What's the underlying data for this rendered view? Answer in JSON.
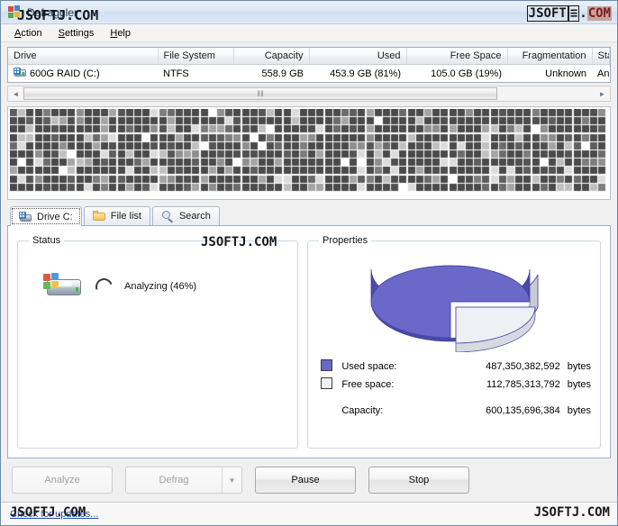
{
  "window": {
    "title": "Defraggler",
    "icon": "app-tiles-icon"
  },
  "watermarks": {
    "title_overlay": "JSOFTJ.COM",
    "titlebar_right": "JSOFTJ.COM",
    "center": "JSOFTJ.COM",
    "status_left": "JSOFTJ.COM",
    "status_right": "JSOFTJ.COM"
  },
  "menu": {
    "items": [
      {
        "accel": "A",
        "rest": "ction"
      },
      {
        "accel": "S",
        "rest": "ettings"
      },
      {
        "accel": "H",
        "rest": "elp"
      }
    ]
  },
  "drive_table": {
    "columns": [
      {
        "label": "Drive",
        "align": "left"
      },
      {
        "label": "File System",
        "align": "left"
      },
      {
        "label": "Capacity",
        "align": "right"
      },
      {
        "label": "Used",
        "align": "right"
      },
      {
        "label": "Free Space",
        "align": "right"
      },
      {
        "label": "Fragmentation",
        "align": "right"
      },
      {
        "label": "Status",
        "align": "left"
      }
    ],
    "rows": [
      {
        "drive": "600G RAID (C:)",
        "file_system": "NTFS",
        "capacity": "558.9 GB",
        "used": "453.9 GB (81%)",
        "free_space": "105.0 GB (19%)",
        "fragmentation": "Unknown",
        "status": "Analyzing ("
      }
    ]
  },
  "scrollbar": {
    "left_arrow": "◄",
    "right_arrow": "►",
    "grip": "‖‖"
  },
  "tabs": [
    {
      "label": "Drive C:",
      "icon": "drive-icon",
      "active": true
    },
    {
      "label": "File list",
      "icon": "folder-icon",
      "active": false
    },
    {
      "label": "Search",
      "icon": "magnifier-icon",
      "active": false
    }
  ],
  "status_group": {
    "legend": "Status",
    "drive_icon": "hard-drive-icon",
    "spinner_icon": "progress-spinner-icon",
    "text": "Analyzing (46%)"
  },
  "properties_group": {
    "legend": "Properties",
    "legend_rows": [
      {
        "swatch": "used",
        "label": "Used space:",
        "value": "487,350,382,592",
        "unit": "bytes"
      },
      {
        "swatch": "free",
        "label": "Free space:",
        "value": "112,785,313,792",
        "unit": "bytes"
      }
    ],
    "capacity_row": {
      "label": "Capacity:",
      "value": "600,135,696,384",
      "unit": "bytes"
    }
  },
  "chart_data": {
    "type": "pie",
    "title": "Properties",
    "labels": [
      "Used space",
      "Free space"
    ],
    "values": [
      487350382592,
      112785313792
    ],
    "percentages": [
      81,
      19
    ],
    "colors": [
      "#6a68c8",
      "#eef0f4"
    ],
    "units": "bytes",
    "total": 600135696384,
    "legend_position": "bottom",
    "style": "3d-exploded"
  },
  "buttons": [
    {
      "label": "Analyze",
      "enabled": false,
      "split": false
    },
    {
      "label": "Defrag",
      "enabled": false,
      "split": true,
      "arrow": "▼"
    },
    {
      "label": "Pause",
      "enabled": true,
      "split": false
    },
    {
      "label": "Stop",
      "enabled": true,
      "split": false
    }
  ],
  "statusbar": {
    "link": "Check for updates..."
  },
  "colors": {
    "used_space": "#6a68c8",
    "free_space": "#eef0f4",
    "window_border": "#6f8ba8",
    "accent": "#3c7fc4"
  }
}
